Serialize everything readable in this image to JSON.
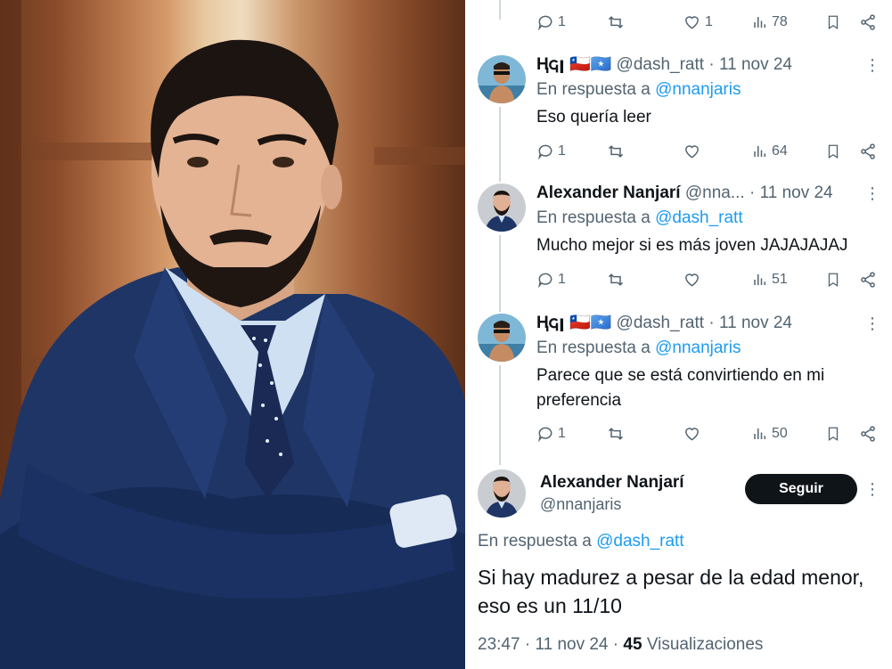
{
  "photo": {
    "description_icon": "person-photo"
  },
  "top_actions": {
    "replies": "1",
    "retweets": "",
    "likes": "1",
    "views": "78"
  },
  "tweets": [
    {
      "display_name": "Ⱨ𐌾ꞁ 🇨🇱🇸🇴",
      "handle": "@dash_ratt",
      "date": "11 nov 24",
      "reply_prefix": "En respuesta a",
      "reply_to": "@nnanjaris",
      "text": "Eso quería leer",
      "replies": "1",
      "views": "64"
    },
    {
      "display_name": "Alexander Nanjarí",
      "handle": "@nna...",
      "date": "11 nov 24",
      "reply_prefix": "En respuesta a",
      "reply_to": "@dash_ratt",
      "text": "Mucho mejor si es más joven JAJAJAJAJ",
      "replies": "1",
      "views": "51"
    },
    {
      "display_name": "Ⱨ𐌾ꞁ 🇨🇱🇸🇴",
      "handle": "@dash_ratt",
      "date": "11 nov 24",
      "reply_prefix": "En respuesta a",
      "reply_to": "@nnanjaris",
      "text": "Parece que se está convirtiendo en mi preferencia",
      "replies": "1",
      "views": "50"
    }
  ],
  "main_tweet": {
    "display_name": "Alexander Nanjarí",
    "handle": "@nnanjaris",
    "follow_label": "Seguir",
    "reply_prefix": "En respuesta a",
    "reply_to": "@dash_ratt",
    "text": "Si hay madurez a pesar de la edad menor, eso es un 11/10",
    "time": "23:47",
    "date": "11 nov 24",
    "views_count": "45",
    "views_label": "Visualizaciones"
  },
  "separator": "·",
  "more_glyph": "⋮",
  "colors": {
    "link": "#1d9bf0",
    "secondary_text": "#536471",
    "primary_text": "#0f1419",
    "thread_line": "#cfd9de"
  }
}
